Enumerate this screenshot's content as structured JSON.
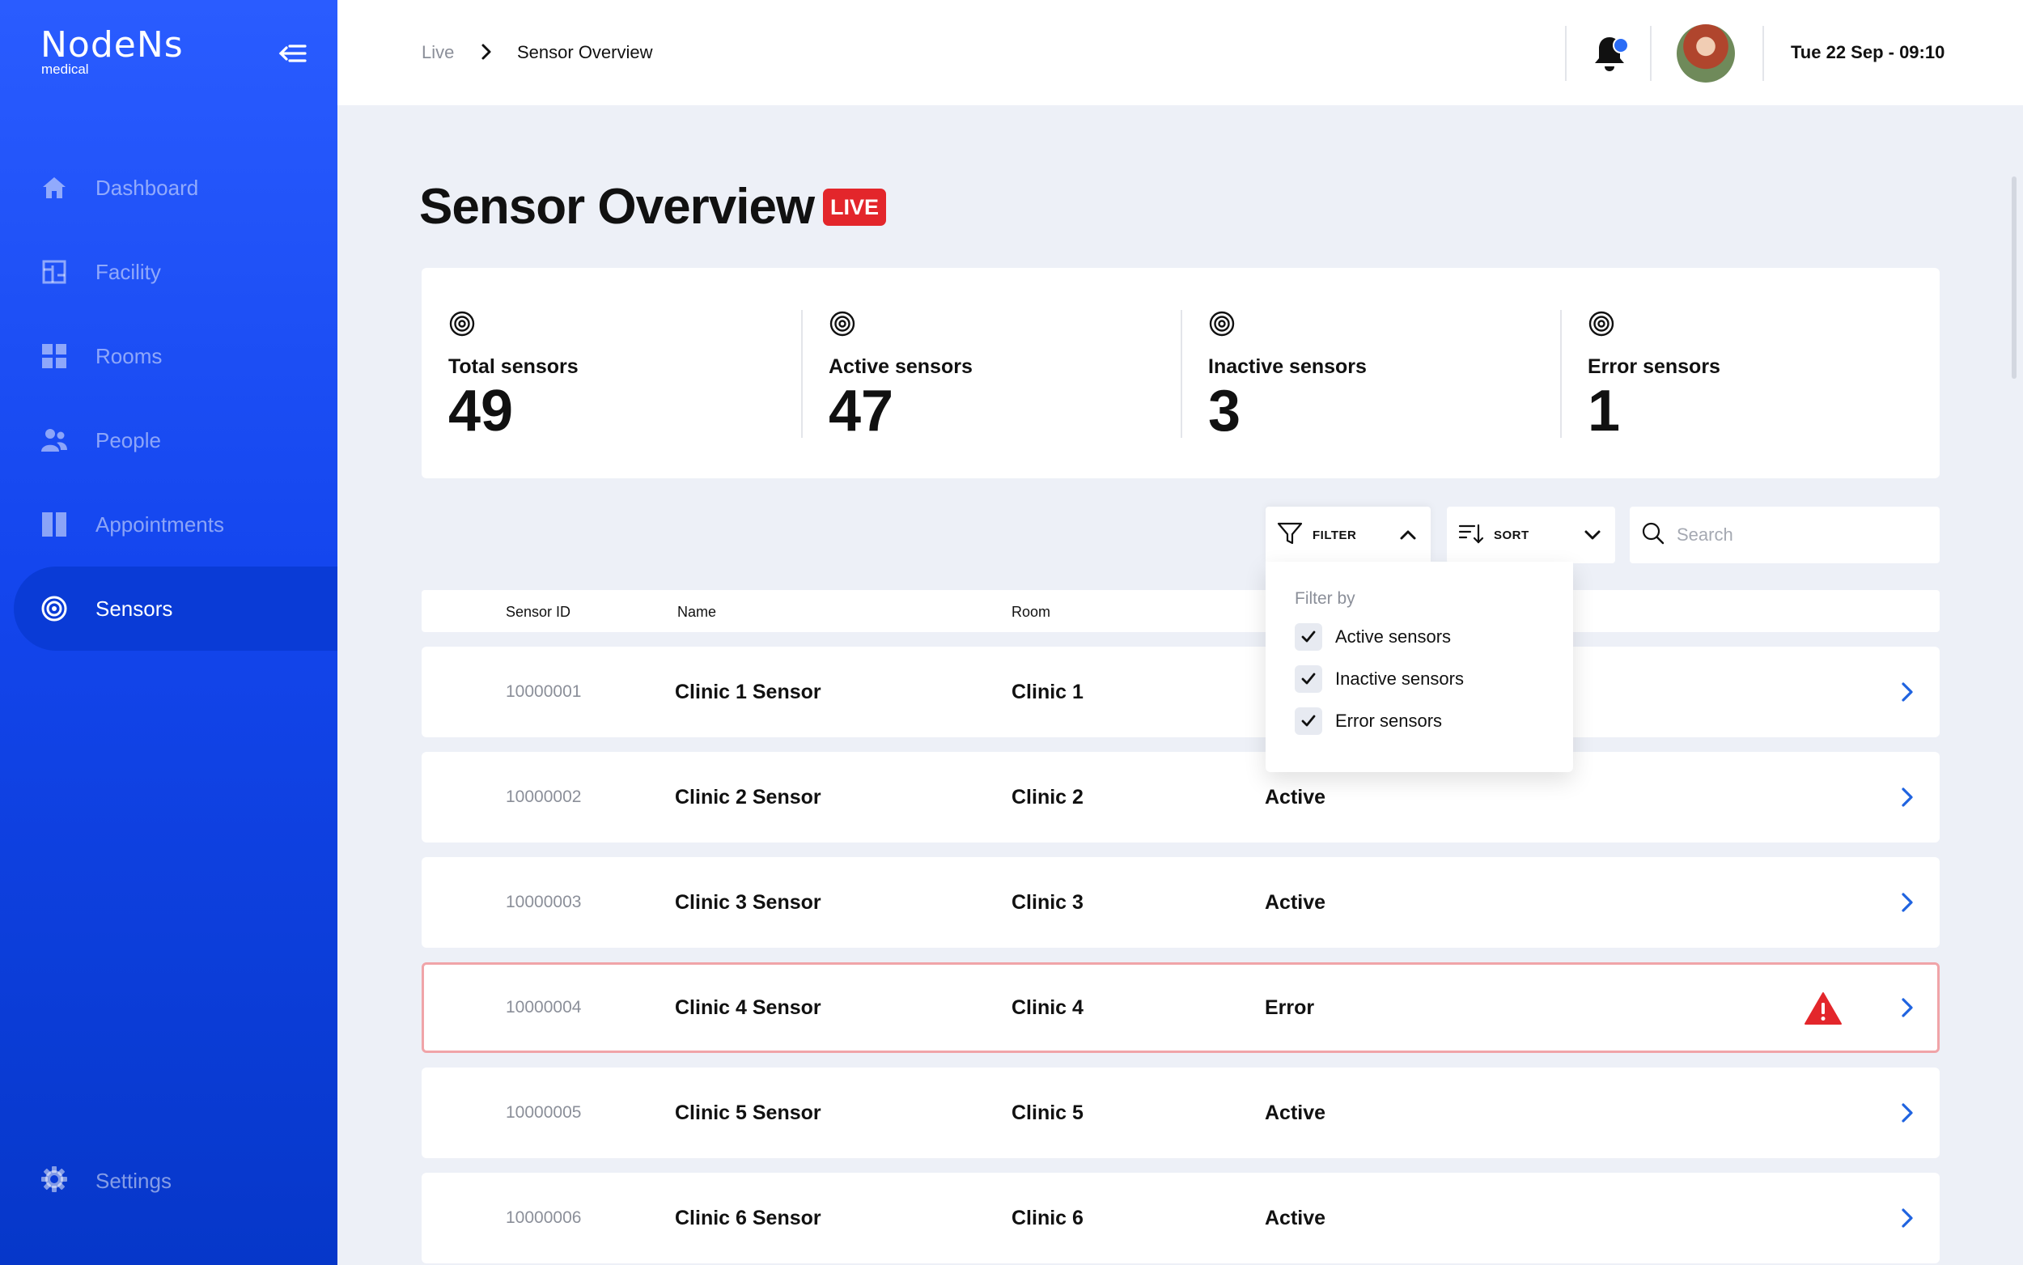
{
  "app": {
    "logo_main": "NodeNs",
    "logo_sub": "medical"
  },
  "sidebar": {
    "items": [
      {
        "label": "Dashboard",
        "icon": "home-icon"
      },
      {
        "label": "Facility",
        "icon": "facility-icon"
      },
      {
        "label": "Rooms",
        "icon": "grid-icon"
      },
      {
        "label": "People",
        "icon": "people-icon"
      },
      {
        "label": "Appointments",
        "icon": "appointments-icon"
      },
      {
        "label": "Sensors",
        "icon": "target-icon",
        "active": true
      }
    ],
    "settings_label": "Settings"
  },
  "header": {
    "breadcrumb_root": "Live",
    "breadcrumb_current": "Sensor Overview",
    "datetime": "Tue 22 Sep - 09:10"
  },
  "page": {
    "title": "Sensor Overview",
    "live_badge": "LIVE"
  },
  "stats": [
    {
      "label": "Total sensors",
      "value": "49"
    },
    {
      "label": "Active sensors",
      "value": "47"
    },
    {
      "label": "Inactive sensors",
      "value": "3"
    },
    {
      "label": "Error sensors",
      "value": "1"
    }
  ],
  "toolbar": {
    "filter_label": "FILTER",
    "sort_label": "SORT",
    "search_placeholder": "Search"
  },
  "filter_dropdown": {
    "title": "Filter by",
    "options": [
      {
        "label": "Active sensors",
        "checked": true
      },
      {
        "label": "Inactive sensors",
        "checked": true
      },
      {
        "label": "Error sensors",
        "checked": true
      }
    ]
  },
  "table": {
    "headers": [
      "Sensor ID",
      "Name",
      "Room"
    ],
    "rows": [
      {
        "id": "10000001",
        "name": "Clinic 1 Sensor",
        "room": "Clinic 1",
        "status": ""
      },
      {
        "id": "10000002",
        "name": "Clinic 2 Sensor",
        "room": "Clinic 2",
        "status": "Active"
      },
      {
        "id": "10000003",
        "name": "Clinic 3 Sensor",
        "room": "Clinic 3",
        "status": "Active"
      },
      {
        "id": "10000004",
        "name": "Clinic 4 Sensor",
        "room": "Clinic 4",
        "status": "Error",
        "error": true
      },
      {
        "id": "10000005",
        "name": "Clinic 5 Sensor",
        "room": "Clinic 5",
        "status": "Active"
      },
      {
        "id": "10000006",
        "name": "Clinic 6 Sensor",
        "room": "Clinic 6",
        "status": "Active"
      }
    ]
  },
  "colors": {
    "accent": "#2a5cff",
    "live": "#e3262b",
    "error_border": "#f0a4a8",
    "chevron": "#1f63e0"
  }
}
